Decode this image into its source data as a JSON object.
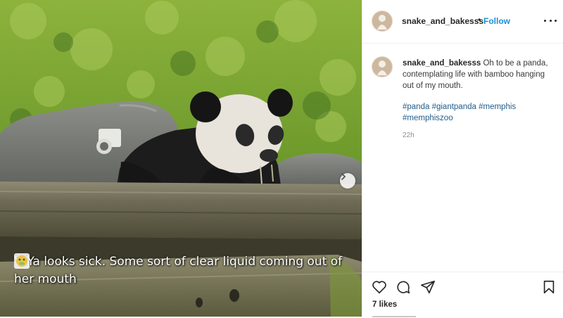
{
  "post": {
    "username": "snake_and_bakesss",
    "follow_label": "Follow",
    "separator": "•",
    "caption_text": "Oh to be a panda, contemplating life with bamboo hanging out of my mouth.",
    "hashtags": [
      "#panda",
      "#giantpanda",
      "#memphis",
      "#memphiszoo"
    ],
    "time_ago": "22h",
    "likes": "7 likes"
  },
  "overlay": {
    "comment_line1": "YaYa looks sick. Some sort of clear liquid coming out of",
    "comment_line2": "her mouth"
  },
  "icons": {
    "more": "more-options-icon",
    "like": "heart-icon",
    "comment": "comment-icon",
    "share": "paper-plane-icon",
    "save": "bookmark-icon",
    "next": "chevron-right-icon"
  },
  "colors": {
    "link": "#1a8fd6",
    "hashtag": "#1e5c8a",
    "text": "#262626",
    "muted": "#8e8e8e"
  }
}
